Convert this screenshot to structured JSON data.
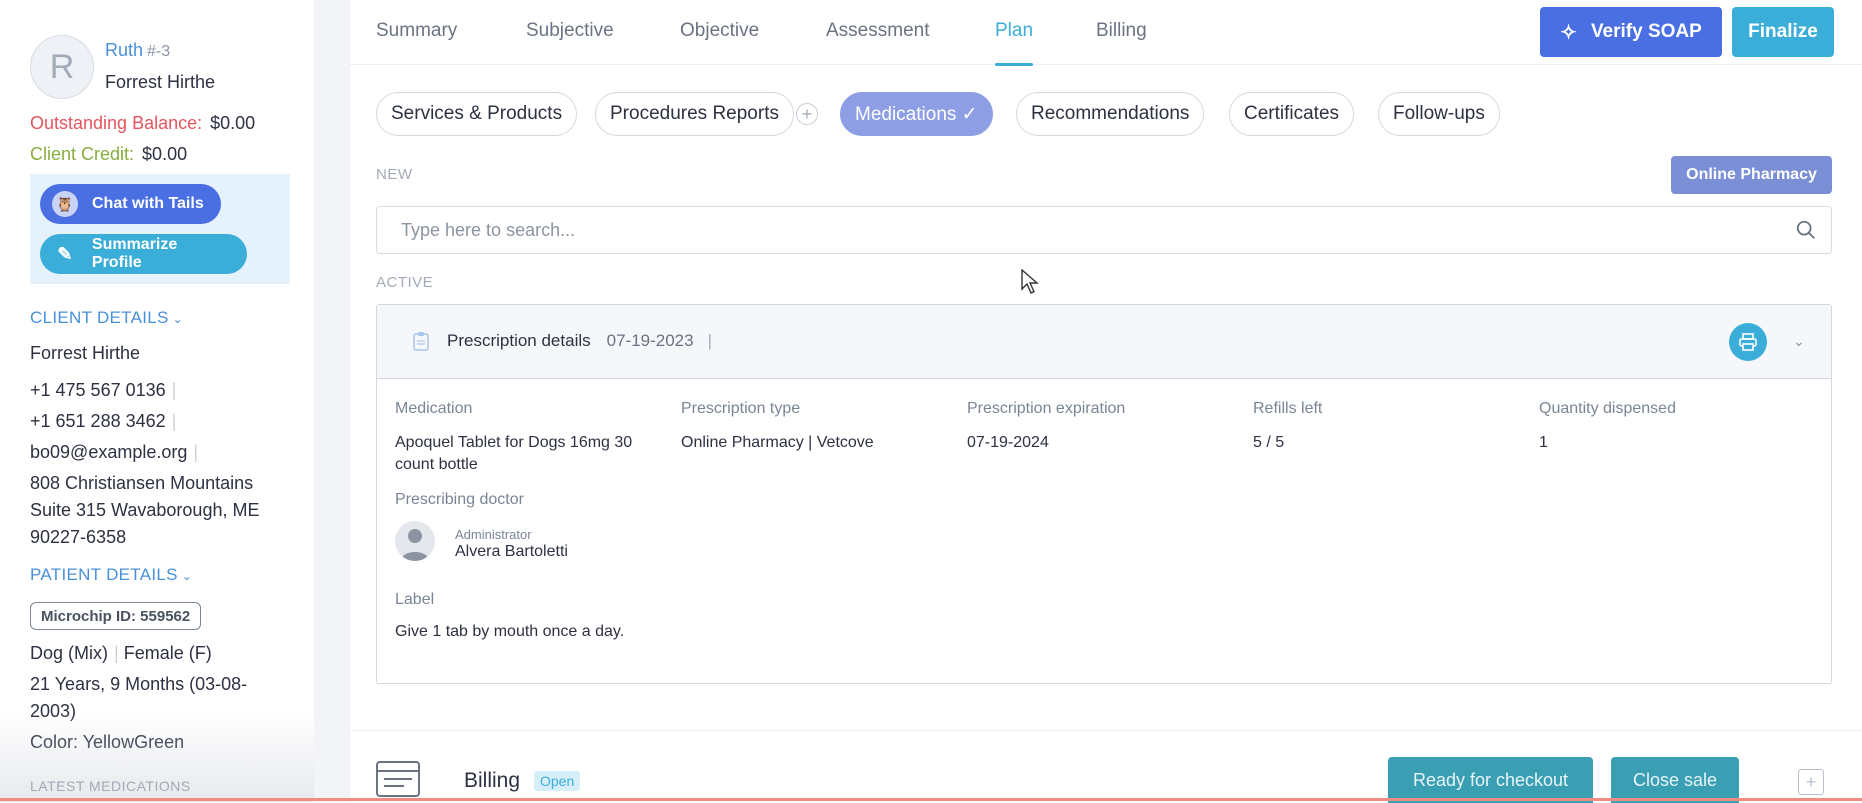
{
  "sidebar": {
    "avatar_letter": "R",
    "pet_name": "Ruth",
    "pet_id": "#-3",
    "owner_name": "Forrest Hirthe",
    "outstanding_label": "Outstanding Balance:",
    "outstanding_value": "$0.00",
    "credit_label": "Client Credit:",
    "credit_value": "$0.00",
    "chat_button": "Chat with Tails",
    "summarize_button": "Summarize Profile",
    "client_details_heading": "CLIENT DETAILS",
    "client": {
      "name": "Forrest Hirthe",
      "phone1": "+1 475 567 0136",
      "phone2": "+1 651 288 3462",
      "email": "bo09@example.org",
      "address_line1": "808 Christiansen Mountains",
      "address_line2": "Suite 315 Wavaborough, ME",
      "address_line3": "90227-6358"
    },
    "patient_details_heading": "PATIENT DETAILS",
    "patient": {
      "microchip": "Microchip ID: 559562",
      "species": "Dog (Mix)",
      "sex": "Female (F)",
      "age_line1": "21 Years, 9 Months (03-08-",
      "age_line2": "2003)",
      "color": "Color: YellowGreen"
    },
    "latest_medications_heading": "LATEST MEDICATIONS"
  },
  "tabs": [
    {
      "label": "Summary"
    },
    {
      "label": "Subjective"
    },
    {
      "label": "Objective"
    },
    {
      "label": "Assessment"
    },
    {
      "label": "Plan"
    },
    {
      "label": "Billing"
    }
  ],
  "active_tab": "Plan",
  "header_buttons": {
    "verify": "Verify SOAP",
    "finalize": "Finalize"
  },
  "pills": [
    {
      "label": "Services & Products"
    },
    {
      "label": "Procedures Reports"
    },
    {
      "label": "Medications ✓"
    },
    {
      "label": "Recommendations"
    },
    {
      "label": "Certificates"
    },
    {
      "label": "Follow-ups"
    }
  ],
  "new_label": "NEW",
  "online_pharmacy_button": "Online Pharmacy",
  "search": {
    "placeholder": "Type here to search..."
  },
  "active_label": "ACTIVE",
  "prescription": {
    "title": "Prescription details",
    "date": "07-19-2023",
    "separator": "|",
    "columns": [
      {
        "header": "Medication",
        "value": "Apoquel Tablet for Dogs 16mg 30 count bottle"
      },
      {
        "header": "Prescription type",
        "value": "Online Pharmacy | Vetcove"
      },
      {
        "header": "Prescription expiration",
        "value": "07-19-2024"
      },
      {
        "header": "Refills left",
        "value": "5 / 5"
      },
      {
        "header": "Quantity dispensed",
        "value": "1"
      }
    ],
    "doctor_label": "Prescribing doctor",
    "doctor_role": "Administrator",
    "doctor_name": "Alvera Bartoletti",
    "label_heading": "Label",
    "label_text": "Give 1 tab by mouth once a day."
  },
  "billing": {
    "title": "Billing",
    "status": "Open",
    "checkout_button": "Ready for checkout",
    "close_button": "Close sale"
  },
  "colors": {
    "primary": "#4a6fe3",
    "accent": "#3aaed8",
    "balance_red": "#e5555e",
    "credit_green": "#8aad3f"
  }
}
